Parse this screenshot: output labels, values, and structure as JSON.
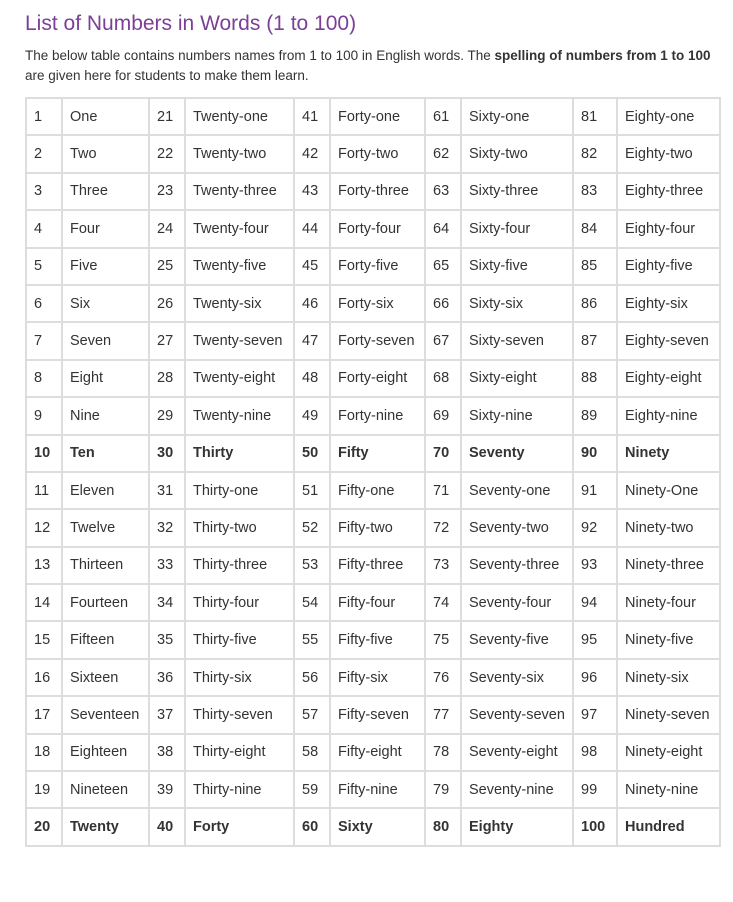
{
  "heading": "List of Numbers in Words (1 to 100)",
  "intro": {
    "text_before": "The below table contains numbers names from 1 to 100 in English words. The ",
    "bold": "spelling of numbers from 1 to 100",
    "text_after": " are given here for students to make them learn."
  },
  "colors": {
    "heading": "#7b3f98",
    "border": "#dddddd",
    "text": "#333333"
  },
  "rows": [
    {
      "bold": false,
      "cells": [
        "1",
        "One",
        "21",
        "Twenty-one",
        "41",
        "Forty-one",
        "61",
        "Sixty-one",
        "81",
        "Eighty-one"
      ]
    },
    {
      "bold": false,
      "cells": [
        "2",
        "Two",
        "22",
        "Twenty-two",
        "42",
        "Forty-two",
        "62",
        "Sixty-two",
        "82",
        "Eighty-two"
      ]
    },
    {
      "bold": false,
      "cells": [
        "3",
        "Three",
        "23",
        "Twenty-three",
        "43",
        "Forty-three",
        "63",
        "Sixty-three",
        "83",
        "Eighty-three"
      ]
    },
    {
      "bold": false,
      "cells": [
        "4",
        "Four",
        "24",
        "Twenty-four",
        "44",
        "Forty-four",
        "64",
        "Sixty-four",
        "84",
        "Eighty-four"
      ]
    },
    {
      "bold": false,
      "cells": [
        "5",
        "Five",
        "25",
        "Twenty-five",
        "45",
        "Forty-five",
        "65",
        "Sixty-five",
        "85",
        "Eighty-five"
      ]
    },
    {
      "bold": false,
      "cells": [
        "6",
        "Six",
        "26",
        "Twenty-six",
        "46",
        "Forty-six",
        "66",
        "Sixty-six",
        "86",
        "Eighty-six"
      ]
    },
    {
      "bold": false,
      "cells": [
        "7",
        "Seven",
        "27",
        "Twenty-seven",
        "47",
        "Forty-seven",
        "67",
        "Sixty-seven",
        "87",
        "Eighty-seven"
      ]
    },
    {
      "bold": false,
      "cells": [
        "8",
        "Eight",
        "28",
        "Twenty-eight",
        "48",
        "Forty-eight",
        "68",
        "Sixty-eight",
        "88",
        "Eighty-eight"
      ]
    },
    {
      "bold": false,
      "cells": [
        "9",
        "Nine",
        "29",
        "Twenty-nine",
        "49",
        "Forty-nine",
        "69",
        "Sixty-nine",
        "89",
        "Eighty-nine"
      ]
    },
    {
      "bold": true,
      "cells": [
        "10",
        "Ten",
        "30",
        "Thirty",
        "50",
        "Fifty",
        "70",
        "Seventy",
        "90",
        "Ninety"
      ]
    },
    {
      "bold": false,
      "cells": [
        "11",
        "Eleven",
        "31",
        "Thirty-one",
        "51",
        "Fifty-one",
        "71",
        "Seventy-one",
        "91",
        "Ninety-One"
      ]
    },
    {
      "bold": false,
      "cells": [
        "12",
        "Twelve",
        "32",
        "Thirty-two",
        "52",
        "Fifty-two",
        "72",
        "Seventy-two",
        "92",
        "Ninety-two"
      ]
    },
    {
      "bold": false,
      "cells": [
        "13",
        "Thirteen",
        "33",
        "Thirty-three",
        "53",
        "Fifty-three",
        "73",
        "Seventy-three",
        "93",
        "Ninety-three"
      ]
    },
    {
      "bold": false,
      "cells": [
        "14",
        "Fourteen",
        "34",
        "Thirty-four",
        "54",
        "Fifty-four",
        "74",
        "Seventy-four",
        "94",
        "Ninety-four"
      ]
    },
    {
      "bold": false,
      "cells": [
        "15",
        "Fifteen",
        "35",
        "Thirty-five",
        "55",
        "Fifty-five",
        "75",
        "Seventy-five",
        "95",
        "Ninety-five"
      ]
    },
    {
      "bold": false,
      "cells": [
        "16",
        "Sixteen",
        "36",
        "Thirty-six",
        "56",
        "Fifty-six",
        "76",
        "Seventy-six",
        "96",
        "Ninety-six"
      ]
    },
    {
      "bold": false,
      "cells": [
        "17",
        "Seventeen",
        "37",
        "Thirty-seven",
        "57",
        "Fifty-seven",
        "77",
        "Seventy-seven",
        "97",
        "Ninety-seven"
      ]
    },
    {
      "bold": false,
      "cells": [
        "18",
        "Eighteen",
        "38",
        "Thirty-eight",
        "58",
        "Fifty-eight",
        "78",
        "Seventy-eight",
        "98",
        "Ninety-eight"
      ]
    },
    {
      "bold": false,
      "cells": [
        "19",
        "Nineteen",
        "39",
        "Thirty-nine",
        "59",
        "Fifty-nine",
        "79",
        "Seventy-nine",
        "99",
        "Ninety-nine"
      ]
    },
    {
      "bold": true,
      "cells": [
        "20",
        "Twenty",
        "40",
        "Forty",
        "60",
        "Sixty",
        "80",
        "Eighty",
        "100",
        "Hundred"
      ]
    }
  ]
}
